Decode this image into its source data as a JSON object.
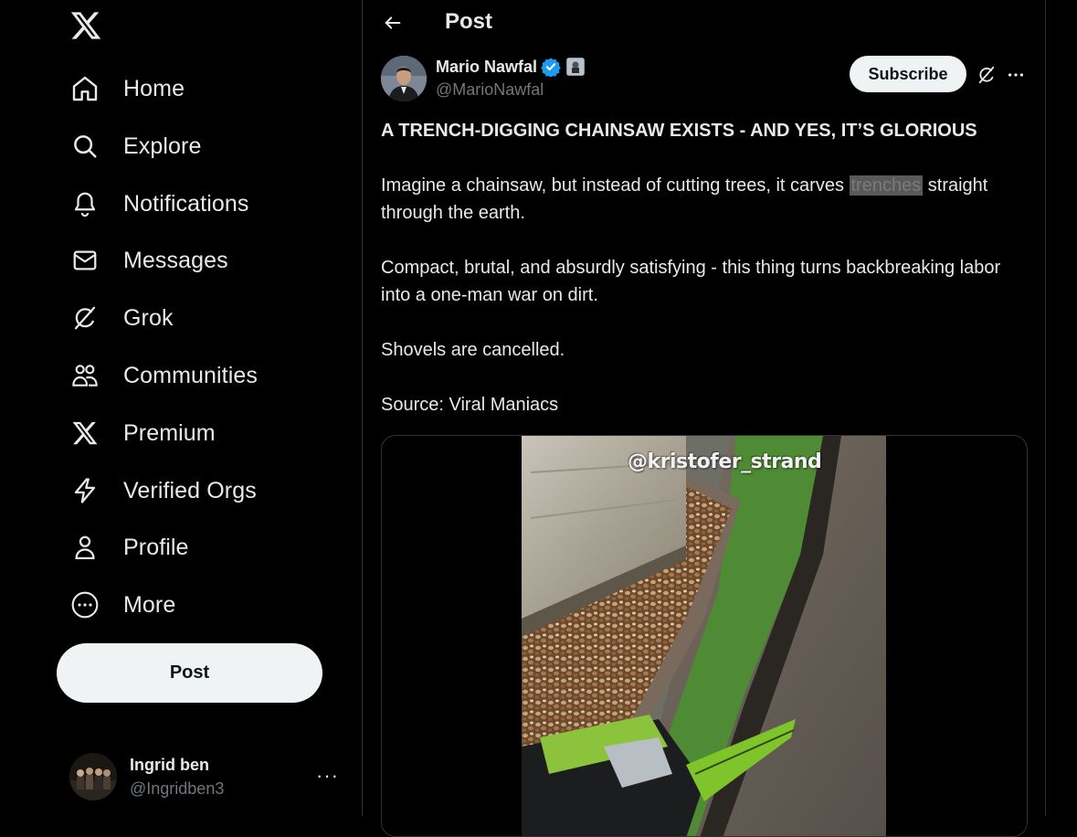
{
  "sidebar": {
    "logo": "x-logo",
    "nav": [
      {
        "label": "Home",
        "icon": "home-icon"
      },
      {
        "label": "Explore",
        "icon": "search-icon"
      },
      {
        "label": "Notifications",
        "icon": "bell-icon"
      },
      {
        "label": "Messages",
        "icon": "envelope-icon"
      },
      {
        "label": "Grok",
        "icon": "grok-icon"
      },
      {
        "label": "Communities",
        "icon": "people-icon"
      },
      {
        "label": "Premium",
        "icon": "x-icon"
      },
      {
        "label": "Verified Orgs",
        "icon": "lightning-icon"
      },
      {
        "label": "Profile",
        "icon": "person-icon"
      },
      {
        "label": "More",
        "icon": "more-circle-icon"
      }
    ],
    "post_label": "Post",
    "account": {
      "name": "Ingrid ben",
      "handle": "@Ingridben3",
      "more": "···"
    }
  },
  "header": {
    "title": "Post"
  },
  "post": {
    "author_name": "Mario Nawfal",
    "author_handle": "@MarioNawfal",
    "subscribe_label": "Subscribe",
    "more": "···",
    "headline": "A TRENCH-DIGGING CHAINSAW EXISTS - AND YES, IT’S GLORIOUS",
    "para1_before": "Imagine a chainsaw, but instead of cutting trees, it carves ",
    "para1_highlight": "trenches",
    "para1_after": " straight through the earth.",
    "para2": "Compact, brutal, and absurdly satisfying - this thing turns backbreaking labor into a one-man war on dirt.",
    "para3": "Shovels are cancelled.",
    "para4": "Source: Viral Maniacs",
    "video_watermark": "@kristofer_strand"
  },
  "colors": {
    "background": "#000000",
    "text": "#e7e9ea",
    "muted": "#71767b",
    "verified": "#1d9bf0",
    "button_bg": "#eff3f4",
    "border": "#2f3336"
  }
}
